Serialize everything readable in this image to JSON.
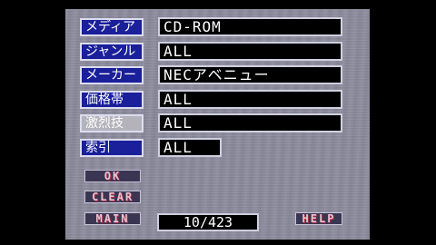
{
  "filters": [
    {
      "label": "メディア",
      "value": "CD-ROM"
    },
    {
      "label": "ジャンル",
      "value": "ALL"
    },
    {
      "label": "メーカー",
      "value": "NECアベニュー"
    },
    {
      "label": "価格帯",
      "value": "ALL"
    },
    {
      "label": "激烈技",
      "value": "ALL"
    },
    {
      "label": "索引",
      "value": "ALL"
    }
  ],
  "buttons": {
    "ok": "OK",
    "clear": "CLEAR",
    "main": "MAIN",
    "help": "HELP"
  },
  "counter": "10/423",
  "colors": {
    "label_bg": "#1a1f9a",
    "label_highlight_bg": "#b4b3bc",
    "panel_bg": "#8d8c9e",
    "button_text": "#e8c0d0"
  }
}
